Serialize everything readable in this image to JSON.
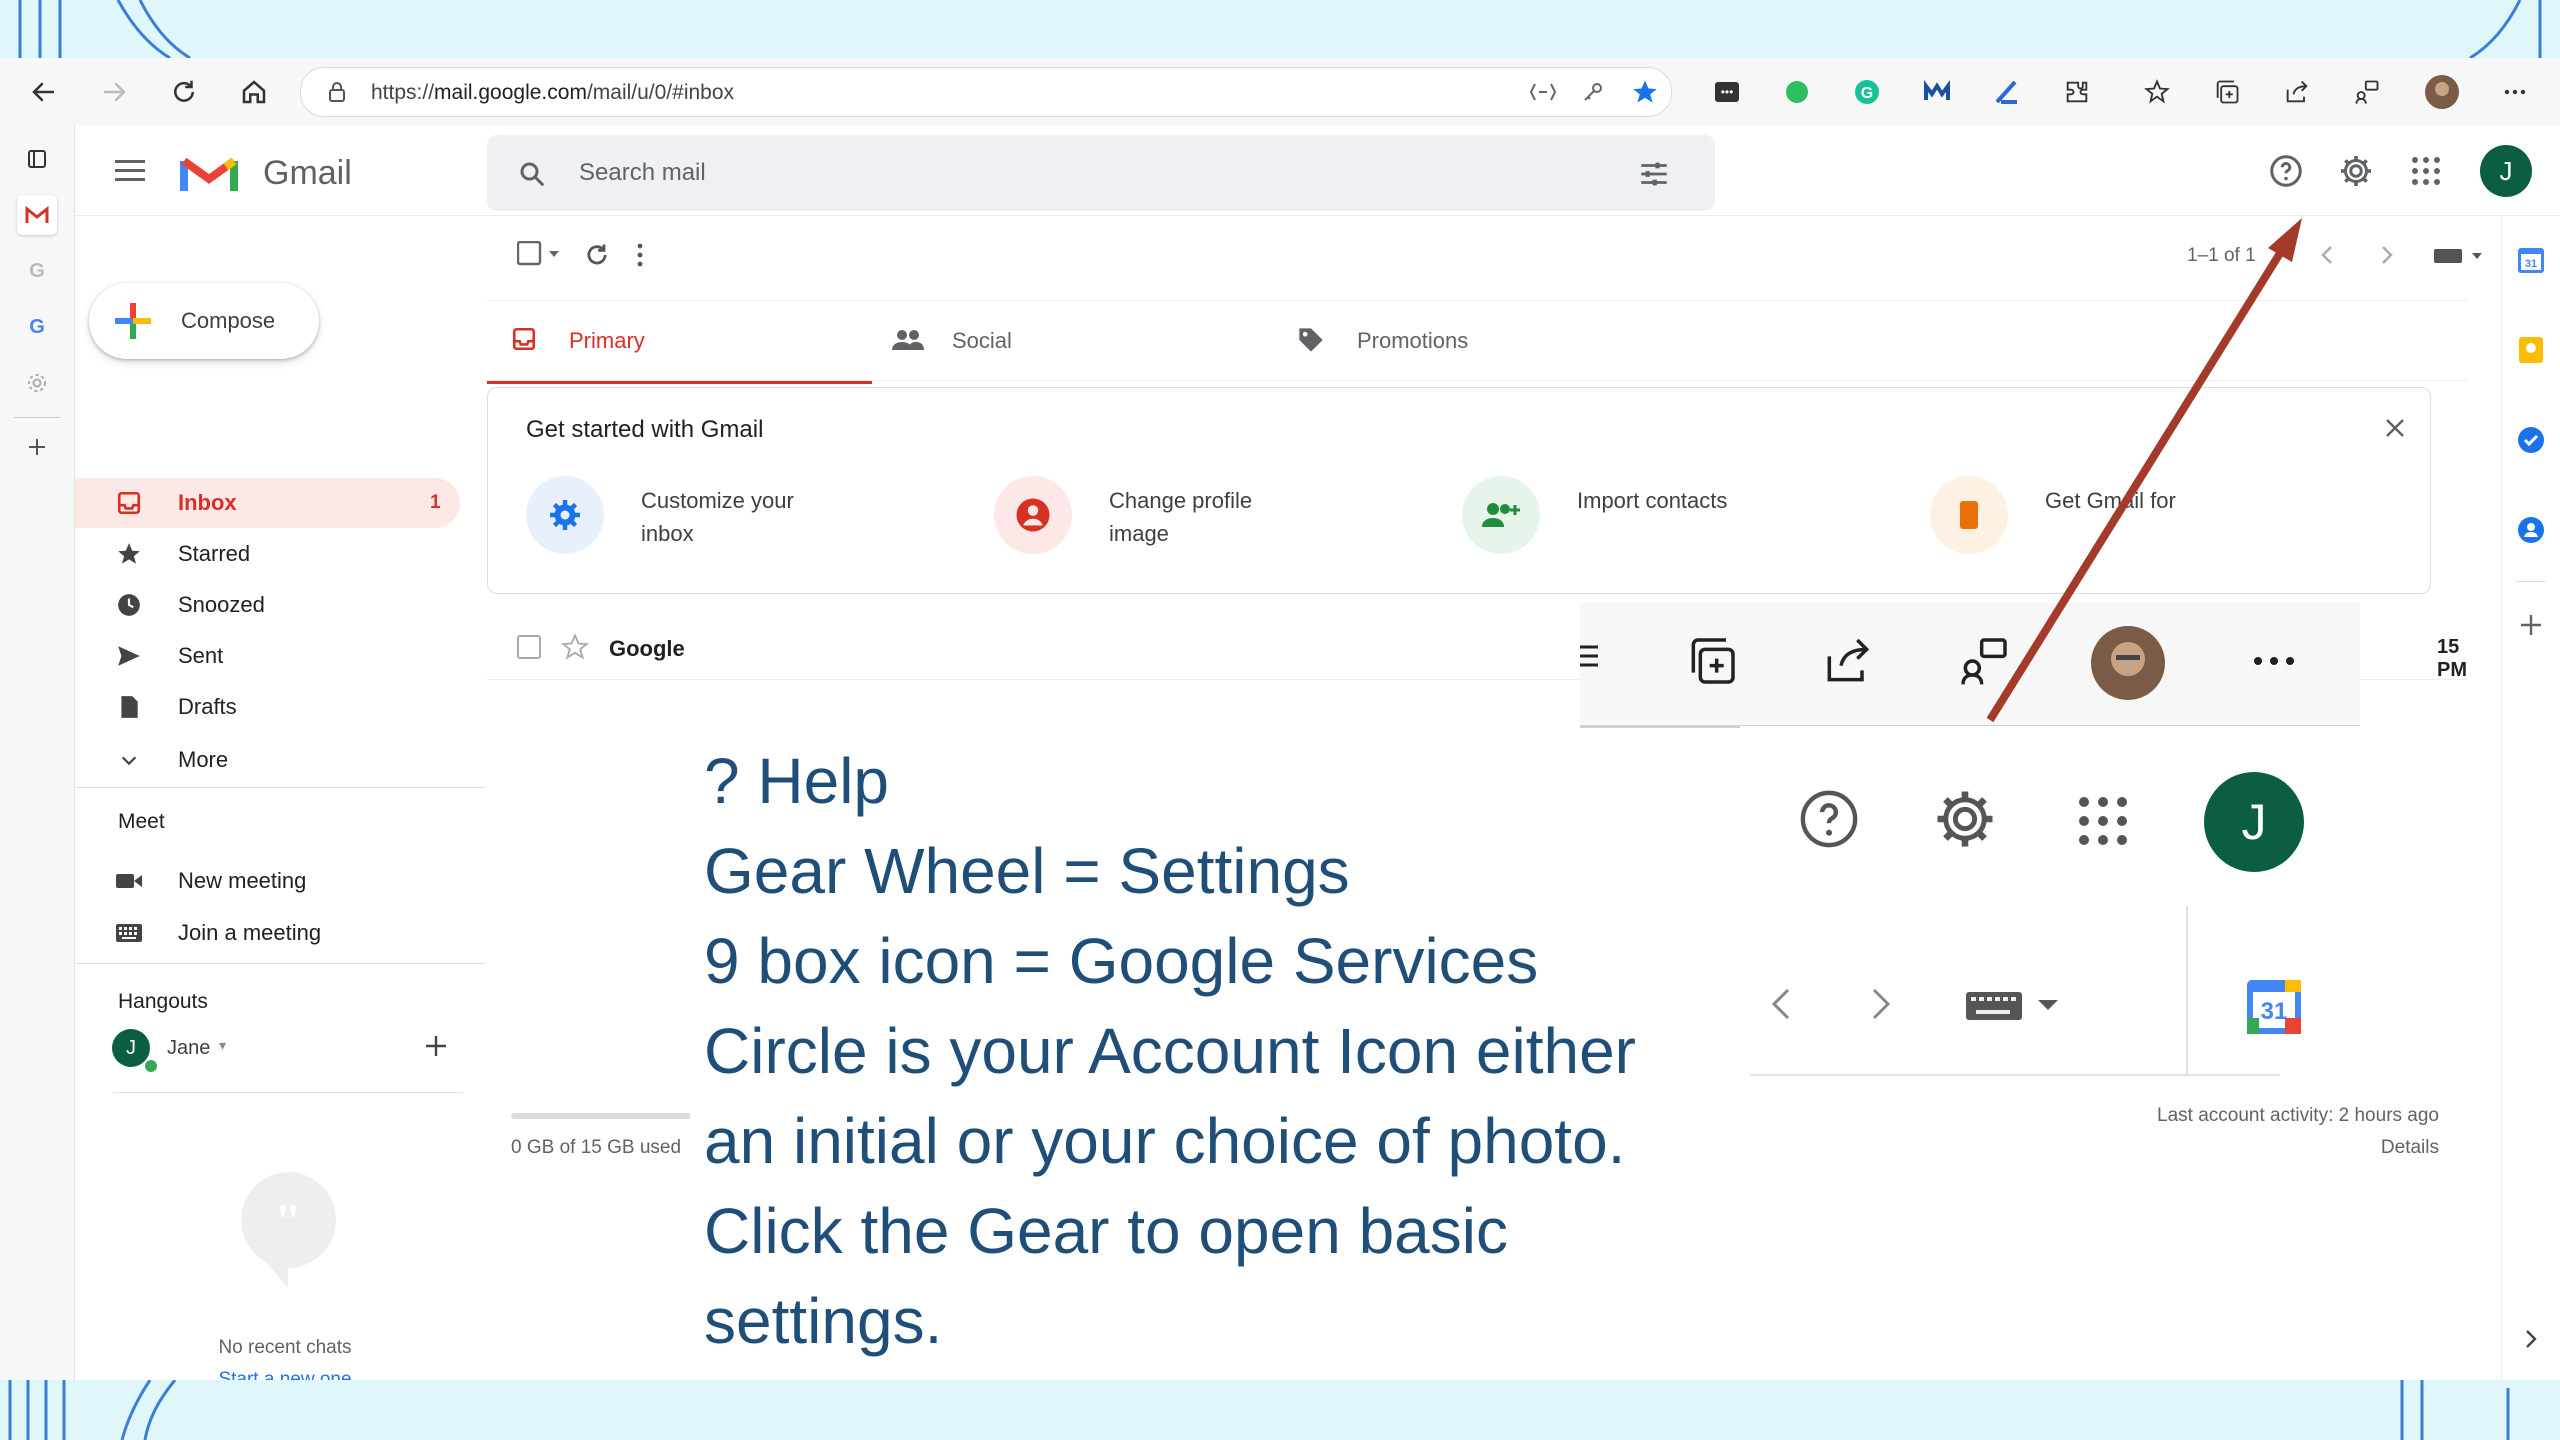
{
  "browser": {
    "url_prefix": "https://",
    "url_host": "mail.google.com",
    "url_path": "/mail/u/0/#inbox"
  },
  "gmail": {
    "logo_text": "Gmail",
    "search_placeholder": "Search mail",
    "account_initial": "J",
    "compose_label": "Compose",
    "nav": [
      {
        "label": "Inbox",
        "count": "1",
        "icon": "inbox-icon"
      },
      {
        "label": "Starred",
        "icon": "star-icon"
      },
      {
        "label": "Snoozed",
        "icon": "clock-icon"
      },
      {
        "label": "Sent",
        "icon": "send-icon"
      },
      {
        "label": "Drafts",
        "icon": "draft-icon"
      },
      {
        "label": "More",
        "icon": "chevron-down-icon"
      }
    ],
    "meet": {
      "heading": "Meet",
      "items": [
        "New meeting",
        "Join a meeting"
      ]
    },
    "hangouts": {
      "heading": "Hangouts",
      "user": "Jane",
      "empty_text": "No recent chats",
      "start_link": "Start a new one"
    },
    "pagination": "1–1 of 1",
    "tabs": [
      "Primary",
      "Social",
      "Promotions"
    ],
    "get_started": {
      "title": "Get started with Gmail",
      "items": [
        {
          "line1": "Customize your",
          "line2": "inbox"
        },
        {
          "line1": "Change profile",
          "line2": "image"
        },
        {
          "line1": "Import contacts",
          "line2": ""
        },
        {
          "line1": "Get Gmail for",
          "line2": ""
        }
      ]
    },
    "email_row": {
      "sender": "Google",
      "time": "15 PM"
    },
    "storage": "0 GB of 15 GB used",
    "activity": {
      "line1": "Last account activity: 2 hours ago",
      "line2": "Details"
    }
  },
  "overlay": {
    "lines": [
      "? Help",
      "Gear Wheel = Settings",
      "9 box icon = Google Services",
      "Circle is your Account Icon either",
      "an initial or your choice of photo.",
      "Click the Gear to open basic",
      "settings."
    ],
    "zoom_account_initial": "J",
    "calendar_number": "31"
  },
  "colors": {
    "gmail_red": "#d93025",
    "slide_bg": "#dff7fb",
    "slide_text": "#1f4e79",
    "arrow": "#a33a2a",
    "account_green": "#0b5d44"
  }
}
